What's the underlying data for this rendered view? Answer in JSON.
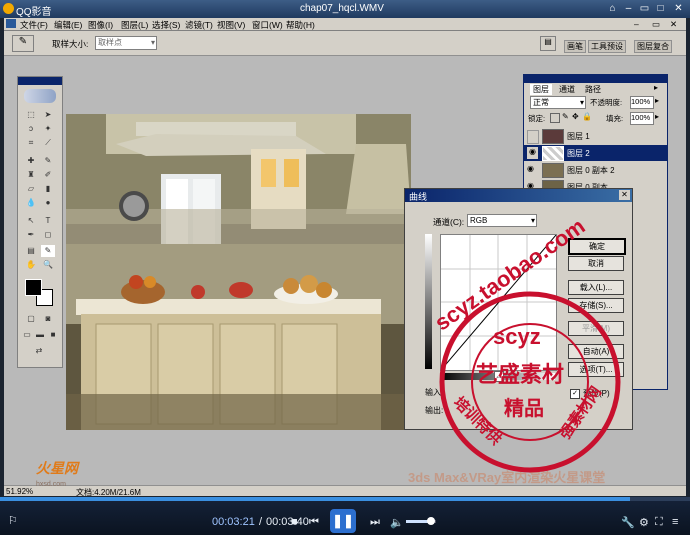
{
  "player": {
    "app_name": "QQ影音",
    "file_name": "chap07_hqcl.WMV",
    "time_current": "00:03:21",
    "time_separator": "/",
    "time_total": "00:03:40"
  },
  "ps": {
    "menus": [
      "文件(F)",
      "编辑(E)",
      "图像(I)",
      "图层(L)",
      "选择(S)",
      "滤镜(T)",
      "视图(V)",
      "窗口(W)",
      "帮助(H)"
    ],
    "options": {
      "sample_size_label": "取样大小:",
      "sample_size_value": "取样点"
    },
    "tabs": [
      "画笔",
      "工具预设",
      "图层复合"
    ],
    "status": {
      "zoom": "51.92%",
      "doc": "文档:4.20M/21.6M"
    }
  },
  "layers": {
    "tabs": [
      "图层",
      "通道",
      "路径"
    ],
    "blend_mode": "正常",
    "opacity_label": "不透明度:",
    "opacity_value": "100%",
    "lock_label": "锁定:",
    "fill_label": "填充:",
    "fill_value": "100%",
    "items": [
      {
        "name": "图层 1",
        "selected": false
      },
      {
        "name": "图层 2",
        "selected": true
      },
      {
        "name": "图层 0 副本 2",
        "selected": false
      },
      {
        "name": "图层 0 副本",
        "selected": false
      }
    ]
  },
  "curves": {
    "title": "曲线",
    "channel_label": "通道(C):",
    "channel_value": "RGB",
    "buttons": [
      "确定",
      "取消",
      "载入(L)...",
      "存储(S)...",
      "平滑(M)",
      "自动(A)",
      "选项(T)..."
    ],
    "input_label": "输入:",
    "output_label": "输出:",
    "preview_label": "预览(P)"
  },
  "watermark": {
    "shop": "scyz.taobao.com",
    "center_top": "scyz",
    "center_mid": "艺盛素材",
    "center_bot": "精品",
    "ring_left": "培训特供",
    "ring_right": "强素材网",
    "site_logo": "火星网",
    "site_url": "hxsd.com",
    "course": "3ds Max&VRay室内渲染火星课堂"
  },
  "colors": {
    "selection": "#0a246a",
    "accent": "#3a6ea5",
    "stamp": "#c8102e"
  }
}
